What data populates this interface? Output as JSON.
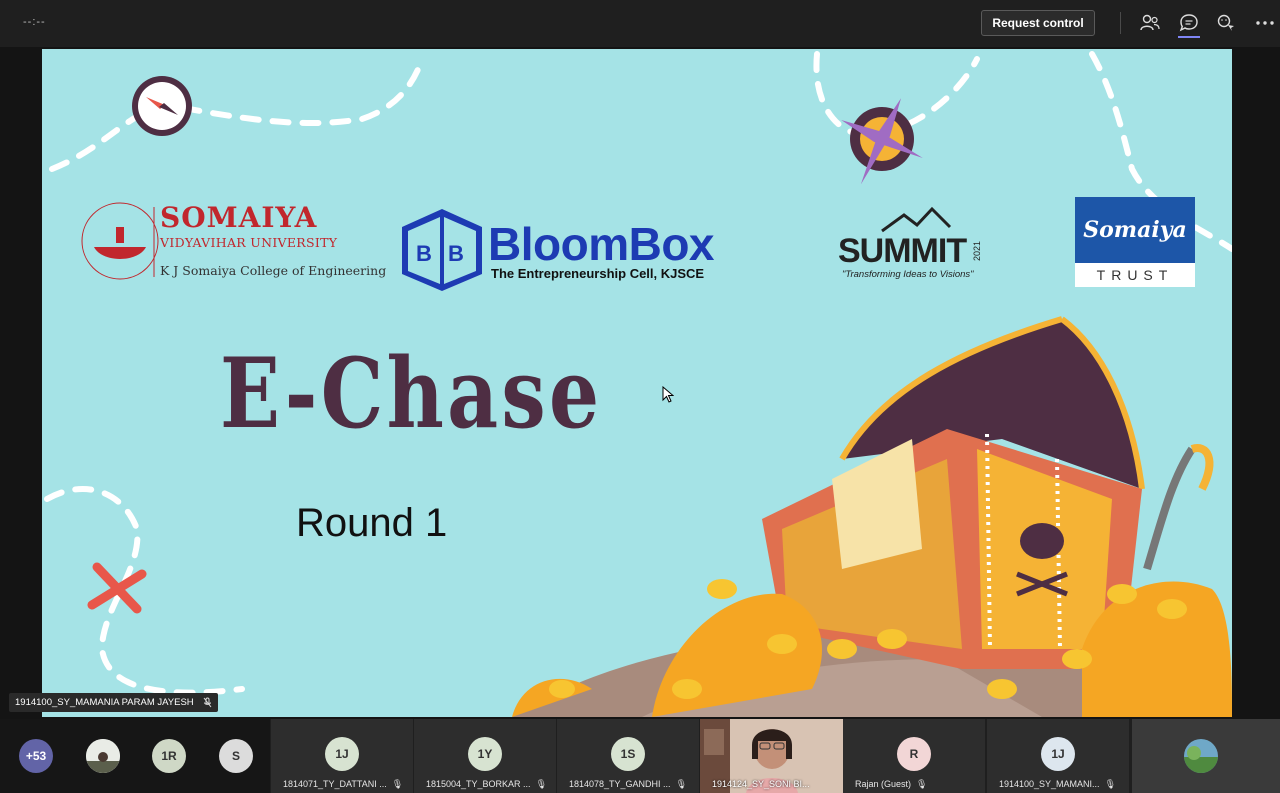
{
  "topbar": {
    "timer": "--:--",
    "request_control": "Request control",
    "icons": [
      "participants-icon",
      "chat-icon",
      "reactions-icon",
      "more-options-icon"
    ]
  },
  "slide": {
    "somaiya_name": "SOMAIYA",
    "somaiya_univ": "VIDYAVIHAR UNIVERSITY",
    "somaiya_college": "K J Somaiya College of Engineering",
    "bloom_title": "BloomBox",
    "bloom_sub": "The  Entrepreneurship Cell, KJSCE",
    "summit_title": "SUMMIT",
    "summit_year": "2021",
    "summit_tag": "\"Transforming Ideas to Visions\"",
    "trust_top": "Somaiya",
    "trust_bottom": "TRUST",
    "title": "E-Chase",
    "subtitle": "Round 1"
  },
  "presenter_tag": "1914100_SY_MAMANIA PARAM JAYESH",
  "roster": {
    "more_count": "+53",
    "initials": [
      "1R",
      "S"
    ]
  },
  "tiles": [
    {
      "initials": "1J",
      "label": "1814071_TY_DATTANI ..."
    },
    {
      "initials": "1Y",
      "label": "1815004_TY_BORKAR ..."
    },
    {
      "initials": "1S",
      "label": "1814078_TY_GANDHI ..."
    },
    {
      "initials": "",
      "label": "1914124_SY_SONI BI..."
    },
    {
      "initials": "R",
      "label": "Rajan (Guest)"
    },
    {
      "initials": "1J",
      "label": "1914100_SY_MAMANI..."
    }
  ],
  "colors": {
    "slide_bg": "#a5e3e6",
    "title": "#4e2e43",
    "accent": "#7f85f5",
    "somaiya_red": "#c1272d",
    "bloom_blue": "#1d3bb3"
  }
}
